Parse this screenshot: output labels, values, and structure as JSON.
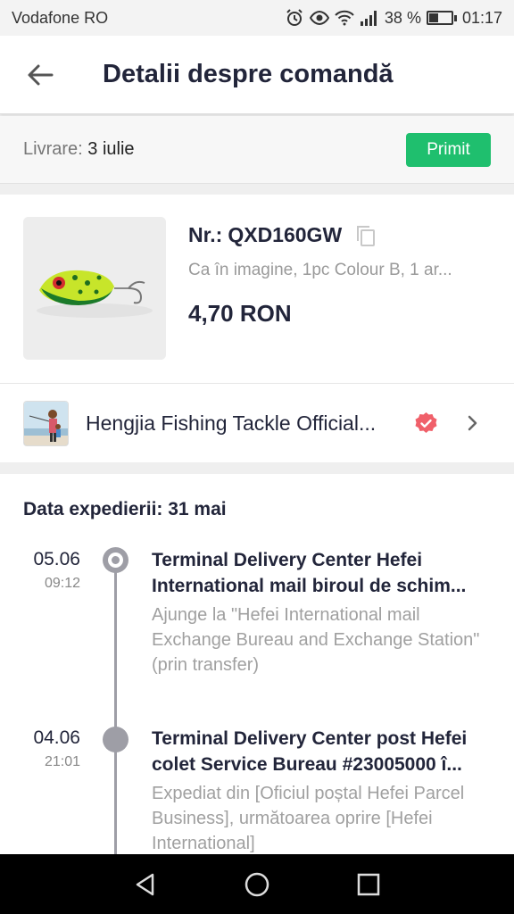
{
  "status_bar": {
    "carrier": "Vodafone RO",
    "battery_text": "38 %",
    "battery_level": 0.38,
    "time": "01:17",
    "icons": [
      "alarm-icon",
      "eye-icon",
      "wifi-icon",
      "signal-icon",
      "battery-icon"
    ]
  },
  "header": {
    "title": "Detalii despre comandă",
    "back_icon": "arrow-left-icon"
  },
  "delivery": {
    "label": "Livrare:",
    "date": "3 iulie",
    "status": "Primit",
    "status_color": "#1fbf6e"
  },
  "product": {
    "order_prefix": "Nr.:",
    "order_number": "QXD160GW",
    "variant": "Ca în imagine, 1pc Colour B, 1 ar...",
    "price": "4,70 RON",
    "copy_icon": "copy-icon"
  },
  "store": {
    "name": "Hengjia Fishing Tackle Official...",
    "verified_icon": "verified-badge-icon",
    "verified_color": "#f0606a"
  },
  "tracking": {
    "ship_label": "Data expedierii: 31 mai",
    "events": [
      {
        "date": "05.06",
        "time": "09:12",
        "title_line1": "Terminal Delivery Center Hefei",
        "title_line2": "International mail biroul de schim...",
        "desc": "Ajunge la \"Hefei International mail Exchange Bureau and Exchange Station\" (prin transfer)"
      },
      {
        "date": "04.06",
        "time": "21:01",
        "title_line1": "Terminal Delivery Center post Hefei",
        "title_line2": "colet Service Bureau #23005000 î...",
        "desc": "Expediat din [Oficiul poștal Hefei Parcel Business], următoarea oprire [Hefei International]"
      }
    ]
  },
  "nav": {
    "icons": [
      "back-triangle-icon",
      "home-circle-icon",
      "recents-square-icon"
    ]
  }
}
